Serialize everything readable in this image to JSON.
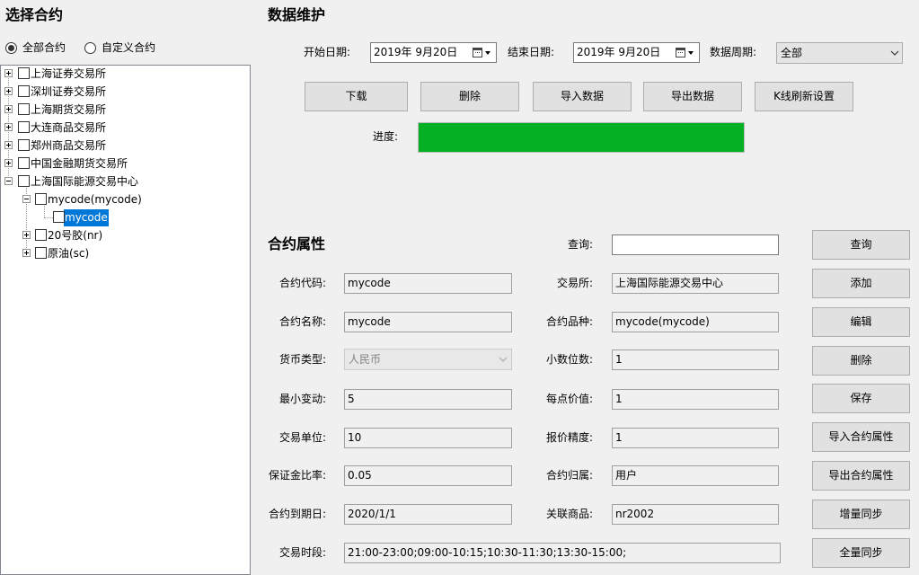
{
  "left": {
    "title": "选择合约",
    "radios": [
      {
        "label": "全部合约",
        "checked": true
      },
      {
        "label": "自定义合约",
        "checked": false
      }
    ],
    "tree": [
      {
        "label": "上海证券交易所",
        "expanded": false,
        "checked": false
      },
      {
        "label": "深圳证券交易所",
        "expanded": false,
        "checked": false
      },
      {
        "label": "上海期货交易所",
        "expanded": false,
        "checked": false
      },
      {
        "label": "大连商品交易所",
        "expanded": false,
        "checked": false
      },
      {
        "label": "郑州商品交易所",
        "expanded": false,
        "checked": false
      },
      {
        "label": "中国金融期货交易所",
        "expanded": false,
        "checked": false
      },
      {
        "label": "上海国际能源交易中心",
        "expanded": true,
        "checked": false,
        "children": [
          {
            "label": "mycode(mycode)",
            "expanded": true,
            "checked": false,
            "children": [
              {
                "label": "mycode",
                "checked": false,
                "selected": true
              }
            ]
          },
          {
            "label": "20号胶(nr)",
            "expanded": false,
            "checked": false
          },
          {
            "label": "原油(sc)",
            "expanded": false,
            "checked": false
          }
        ]
      }
    ]
  },
  "maintenance": {
    "title": "数据维护",
    "start_date_label": "开始日期:",
    "start_date": "2019年 9月20日",
    "end_date_label": "结束日期:",
    "end_date": "2019年 9月20日",
    "period_label": "数据周期:",
    "period": "全部",
    "buttons": [
      "下载",
      "删除",
      "导入数据",
      "导出数据",
      "K线刷新设置"
    ],
    "progress_label": "进度:",
    "progress_percent": 100
  },
  "contract": {
    "title": "合约属性",
    "query_label": "查询:",
    "query_value": "",
    "fields_left": [
      {
        "label": "合约代码:",
        "value": "mycode"
      },
      {
        "label": "合约名称:",
        "value": "mycode"
      },
      {
        "label": "货币类型:",
        "value": "人民币",
        "disabled": true
      },
      {
        "label": "最小变动:",
        "value": "5"
      },
      {
        "label": "交易单位:",
        "value": "10"
      },
      {
        "label": "保证金比率:",
        "value": "0.05"
      },
      {
        "label": "合约到期日:",
        "value": "2020/1/1"
      }
    ],
    "fields_right": [
      {
        "label": "交易所:",
        "value": "上海国际能源交易中心"
      },
      {
        "label": "合约品种:",
        "value": "mycode(mycode)"
      },
      {
        "label": "小数位数:",
        "value": "1"
      },
      {
        "label": "每点价值:",
        "value": "1"
      },
      {
        "label": "报价精度:",
        "value": "1"
      },
      {
        "label": "合约归属:",
        "value": "用户"
      },
      {
        "label": "关联商品:",
        "value": "nr2002"
      }
    ],
    "trading_hours_label": "交易时段:",
    "trading_hours": "21:00-23:00;09:00-10:15;10:30-11:30;13:30-15:00;",
    "buttons": [
      "查询",
      "添加",
      "编辑",
      "删除",
      "保存",
      "导入合约属性",
      "导出合约属性",
      "增量同步",
      "全量同步"
    ]
  },
  "colors": {
    "background": "#f0f0f0",
    "progress": "#06b025",
    "selection": "#0078d7",
    "button": "#e1e1e1"
  },
  "icons": {
    "tree_collapsed": "plus-box-icon",
    "tree_expanded": "minus-box-icon",
    "date_picker": "calendar-icon",
    "dropdown": "chevron-down-icon"
  }
}
